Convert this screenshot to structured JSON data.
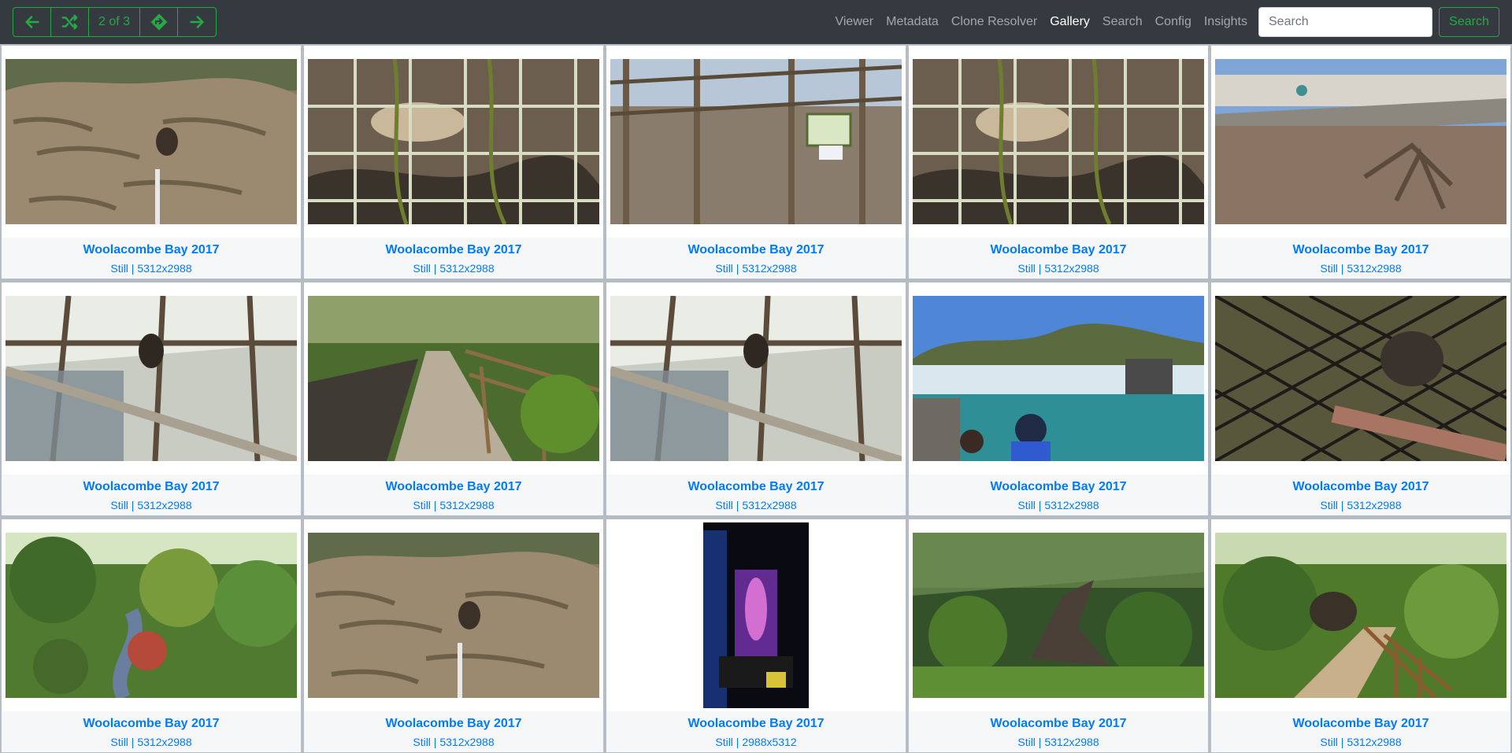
{
  "nav": {
    "counter": "2 of 3",
    "links": [
      "Viewer",
      "Metadata",
      "Clone Resolver",
      "Gallery",
      "Search",
      "Config",
      "Insights"
    ],
    "active_link": "Gallery",
    "search_placeholder": "Search",
    "search_button": "Search",
    "accent_color": "#28a745",
    "link_color": "#007bff"
  },
  "gallery": {
    "items": [
      {
        "title": "Woolacombe Bay 2017",
        "meta": "Still | 5312x2988",
        "scene": "rock-enclosure"
      },
      {
        "title": "Woolacombe Bay 2017",
        "meta": "Still | 5312x2988",
        "scene": "wire-fence-closeup"
      },
      {
        "title": "Woolacombe Bay 2017",
        "meta": "Still | 5312x2988",
        "scene": "aviary-gate"
      },
      {
        "title": "Woolacombe Bay 2017",
        "meta": "Still | 5312x2988",
        "scene": "wire-fence-closeup"
      },
      {
        "title": "Woolacombe Bay 2017",
        "meta": "Still | 5312x2988",
        "scene": "meerkat-enclosure"
      },
      {
        "title": "Woolacombe Bay 2017",
        "meta": "Still | 5312x2988",
        "scene": "branch-monkey"
      },
      {
        "title": "Woolacombe Bay 2017",
        "meta": "Still | 5312x2988",
        "scene": "woodland-path"
      },
      {
        "title": "Woolacombe Bay 2017",
        "meta": "Still | 5312x2988",
        "scene": "branch-monkey"
      },
      {
        "title": "Woolacombe Bay 2017",
        "meta": "Still | 5312x2988",
        "scene": "sea-lion-pool"
      },
      {
        "title": "Woolacombe Bay 2017",
        "meta": "Still | 5312x2988",
        "scene": "chain-link-fence"
      },
      {
        "title": "Woolacombe Bay 2017",
        "meta": "Still | 5312x2988",
        "scene": "garden-stream"
      },
      {
        "title": "Woolacombe Bay 2017",
        "meta": "Still | 5312x2988",
        "scene": "rock-enclosure"
      },
      {
        "title": "Woolacombe Bay 2017",
        "meta": "Still | 2988x5312",
        "scene": "dark-tunnel-lights"
      },
      {
        "title": "Woolacombe Bay 2017",
        "meta": "Still | 5312x2988",
        "scene": "jungle-dinosaur"
      },
      {
        "title": "Woolacombe Bay 2017",
        "meta": "Still | 5312x2988",
        "scene": "fern-boardwalk"
      }
    ]
  }
}
